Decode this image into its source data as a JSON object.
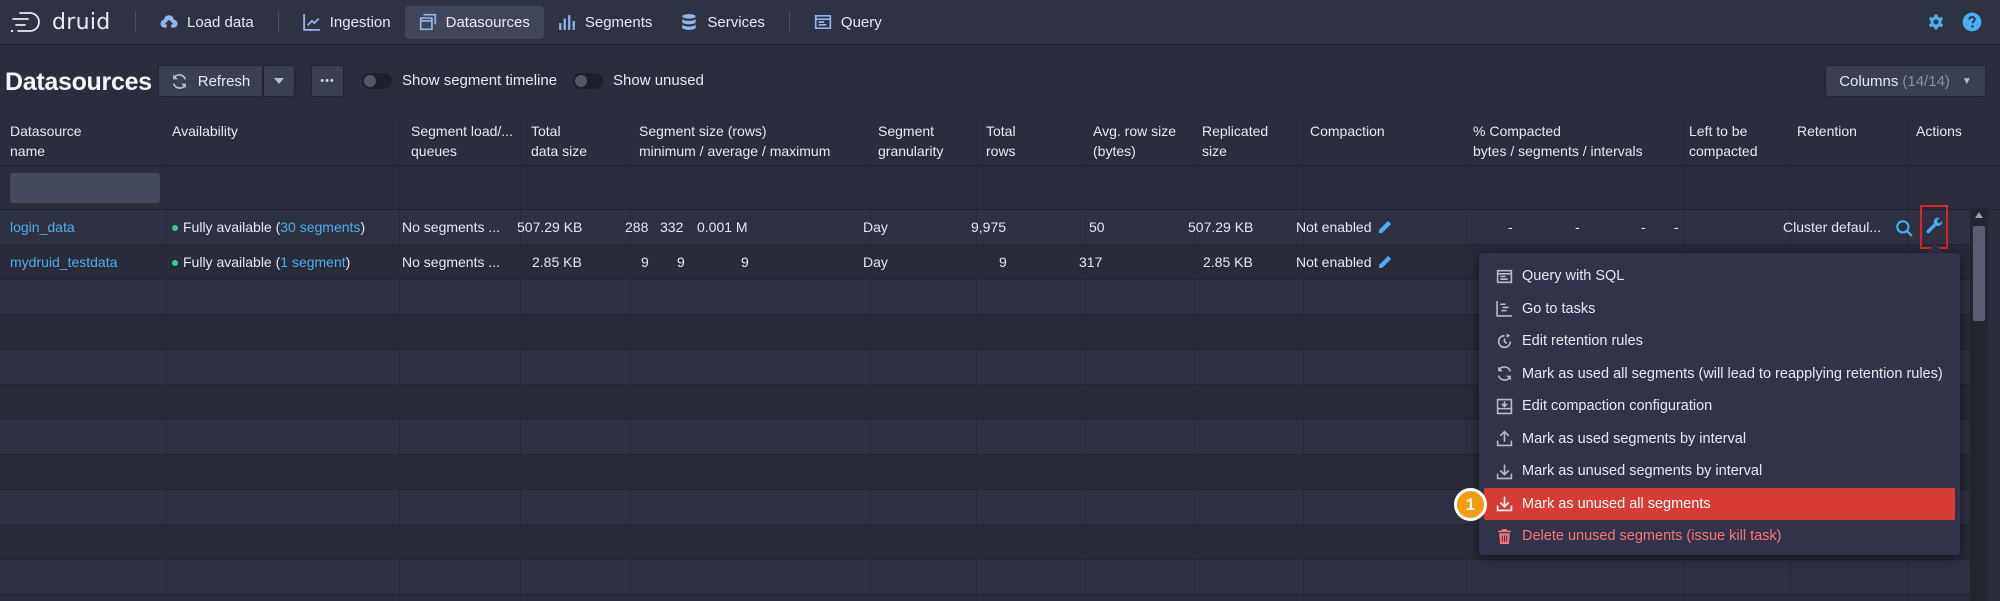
{
  "app": {
    "brand": "druid"
  },
  "nav": {
    "items": [
      {
        "label": "Load data",
        "icon": "cloud-upload-icon"
      },
      {
        "label": "Ingestion",
        "icon": "chart-icon"
      },
      {
        "label": "Datasources",
        "icon": "multi-window-icon",
        "active": true
      },
      {
        "label": "Segments",
        "icon": "bar-chart-icon"
      },
      {
        "label": "Services",
        "icon": "database-icon"
      },
      {
        "label": "Query",
        "icon": "application-icon"
      }
    ]
  },
  "toolbar": {
    "title": "Datasources",
    "refresh_label": "Refresh",
    "more_label": "•••",
    "timeline_label": "Show segment timeline",
    "unused_label": "Show unused",
    "columns_label": "Columns",
    "columns_count": "(14/14)"
  },
  "table": {
    "headers": [
      [
        "Datasource",
        "name"
      ],
      [
        "Availability",
        ""
      ],
      [
        "Segment load/...",
        "queues"
      ],
      [
        "Total",
        "data size"
      ],
      [
        "Segment size (rows)",
        "minimum / average / maximum"
      ],
      [
        "Segment",
        "granularity"
      ],
      [
        "Total",
        "rows"
      ],
      [
        "Avg. row size",
        "(bytes)"
      ],
      [
        "Replicated",
        "size"
      ],
      [
        "Compaction",
        ""
      ],
      [
        "% Compacted",
        "bytes / segments / intervals"
      ],
      [
        "Left to be",
        "compacted"
      ],
      [
        "Retention",
        ""
      ],
      [
        "Actions",
        ""
      ]
    ],
    "rows": [
      {
        "name": "login_data",
        "availability_prefix": "Fully available (",
        "availability_link": "30 segments",
        "availability_suffix": ")",
        "load_queues": "No segments ...",
        "total_size": "507.29 KB",
        "seg_min": "288",
        "seg_avg": "332",
        "seg_max": "0.001 M",
        "granularity": "Day",
        "total_rows": "9,975",
        "avg_row_size": "50",
        "replicated_size": "507.29 KB",
        "compaction": "Not enabled",
        "pct_bytes": "-",
        "pct_segments": "-",
        "pct_intervals": "-",
        "left": "-",
        "retention": "Cluster defaul..."
      },
      {
        "name": "mydruid_testdata",
        "availability_prefix": "Fully available (",
        "availability_link": "1 segment",
        "availability_suffix": ")",
        "load_queues": "No segments ...",
        "total_size": "2.85 KB",
        "seg_min": "9",
        "seg_avg": "9",
        "seg_max": "9",
        "granularity": "Day",
        "total_rows": "9",
        "avg_row_size": "317",
        "replicated_size": "2.85 KB",
        "compaction": "Not enabled"
      }
    ]
  },
  "menu": {
    "items": [
      {
        "label": "Query with SQL",
        "icon": "application-icon"
      },
      {
        "label": "Go to tasks",
        "icon": "gantt-chart-icon"
      },
      {
        "label": "Edit retention rules",
        "icon": "automatic-updates-icon"
      },
      {
        "label": "Mark as used all segments (will lead to reapplying retention rules)",
        "icon": "refresh-icon"
      },
      {
        "label": "Edit compaction configuration",
        "icon": "compressed-icon"
      },
      {
        "label": "Mark as used segments by interval",
        "icon": "upload-icon"
      },
      {
        "label": "Mark as unused segments by interval",
        "icon": "download-icon"
      },
      {
        "label": "Mark as unused all segments",
        "icon": "download-icon",
        "selected": true
      },
      {
        "label": "Delete unused segments (issue kill task)",
        "icon": "trash-icon",
        "danger": true
      }
    ]
  },
  "annotation": {
    "step": "1"
  },
  "colors": {
    "accent": "#48aff0",
    "selected": "#d63b36",
    "danger": "#ff7373",
    "badge": "#f39c12",
    "available": "#3dcc91"
  }
}
